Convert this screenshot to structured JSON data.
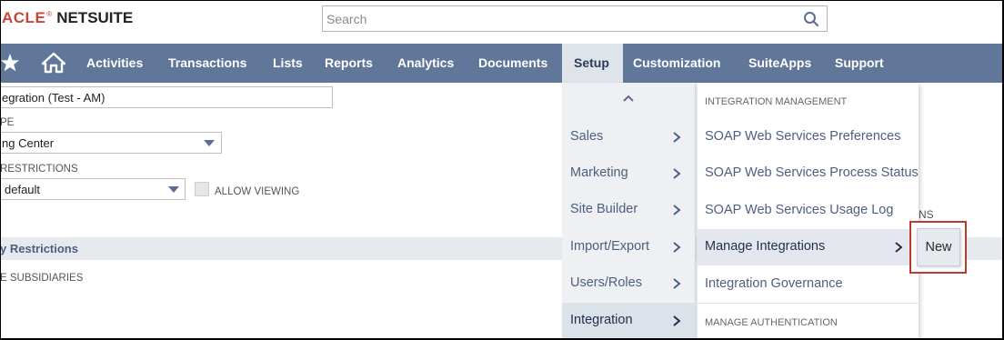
{
  "brand": {
    "oracle": "ACLE",
    "reg": "®",
    "netsuite": "NETSUITE"
  },
  "search": {
    "placeholder": "Search",
    "icon": "search-icon"
  },
  "nav": {
    "items": [
      "Activities",
      "Transactions",
      "Lists",
      "Reports",
      "Analytics",
      "Documents",
      "Setup",
      "Customization",
      "SuiteApps",
      "Support"
    ],
    "active": "Setup",
    "icons": [
      "star-icon",
      "home-icon"
    ]
  },
  "form": {
    "name_value": "egration (Test - AM)",
    "type_label": "PE",
    "type_value": "ng Center",
    "restrictions_label": "RESTRICTIONS",
    "restrictions_value": "default",
    "allow_viewing": "ALLOW VIEWING",
    "section_title": "y Restrictions",
    "subsidiaries_label": "E SUBSIDIARIES",
    "bg_fragment": "NS"
  },
  "setup_menu": {
    "items": [
      "Sales",
      "Marketing",
      "Site Builder",
      "Import/Export",
      "Users/Roles",
      "Integration"
    ],
    "active": "Integration"
  },
  "submenu": {
    "heading1": "INTEGRATION MANAGEMENT",
    "items": [
      "SOAP Web Services Preferences",
      "SOAP Web Services Process Status",
      "SOAP Web Services Usage Log",
      "Manage Integrations",
      "Integration Governance"
    ],
    "active": "Manage Integrations",
    "heading2": "MANAGE AUTHENTICATION"
  },
  "flyout": {
    "new_label": "New"
  },
  "colors": {
    "navbar": "#607799",
    "highlight": "#c0392b",
    "menu_text": "#4c5f80"
  }
}
